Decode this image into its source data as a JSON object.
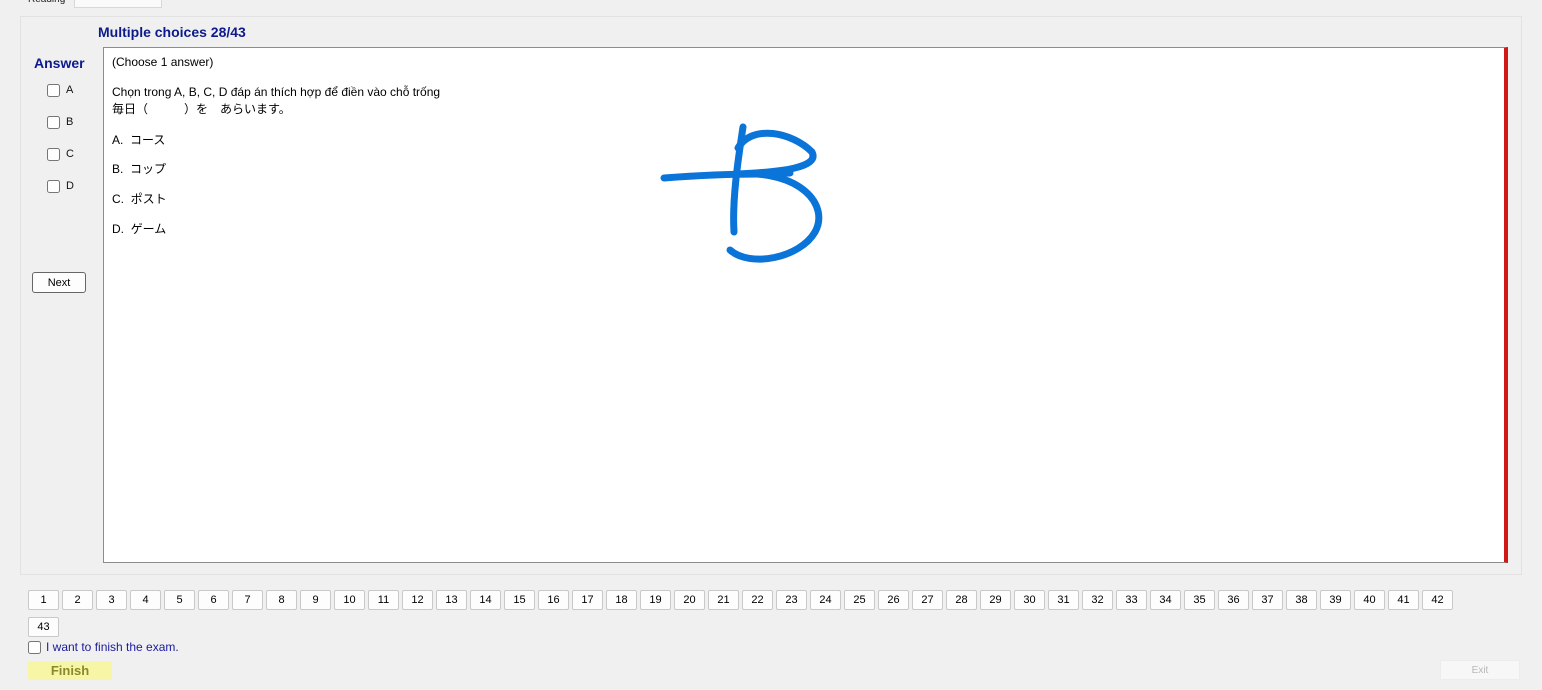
{
  "tabs": [
    {
      "label": "Reading"
    },
    {
      "label": ""
    }
  ],
  "section_title": "Multiple choices 28/43",
  "answer_panel": {
    "heading": "Answer",
    "options": [
      "A",
      "B",
      "C",
      "D"
    ],
    "next_label": "Next"
  },
  "question": {
    "instruction": "(Choose 1 answer)",
    "prompt_line1": "Chọn trong A, B, C, D đáp án thích hợp để điền vào chỗ trống",
    "prompt_line2": "毎日（　　　）を　あらいます。",
    "choices": [
      "A.  コース",
      "B.  コップ",
      "C.  ポスト",
      "D.  ゲーム"
    ]
  },
  "handwritten_annotation": {
    "text": "B",
    "color": "#0a74d8"
  },
  "navigation": {
    "questions": [
      "1",
      "2",
      "3",
      "4",
      "5",
      "6",
      "7",
      "8",
      "9",
      "10",
      "11",
      "12",
      "13",
      "14",
      "15",
      "16",
      "17",
      "18",
      "19",
      "20",
      "21",
      "22",
      "23",
      "24",
      "25",
      "26",
      "27",
      "28",
      "29",
      "30",
      "31",
      "32",
      "33",
      "34",
      "35",
      "36",
      "37",
      "38",
      "39",
      "40",
      "41",
      "42",
      "43"
    ]
  },
  "finish_confirm_label": "I want to finish the exam.",
  "finish_label": "Finish",
  "exit_label": "Exit",
  "colors": {
    "title_blue": "#0c1a8c",
    "scroll_indicator_red": "#d01818",
    "finish_yellow": "#f7f5a6"
  }
}
